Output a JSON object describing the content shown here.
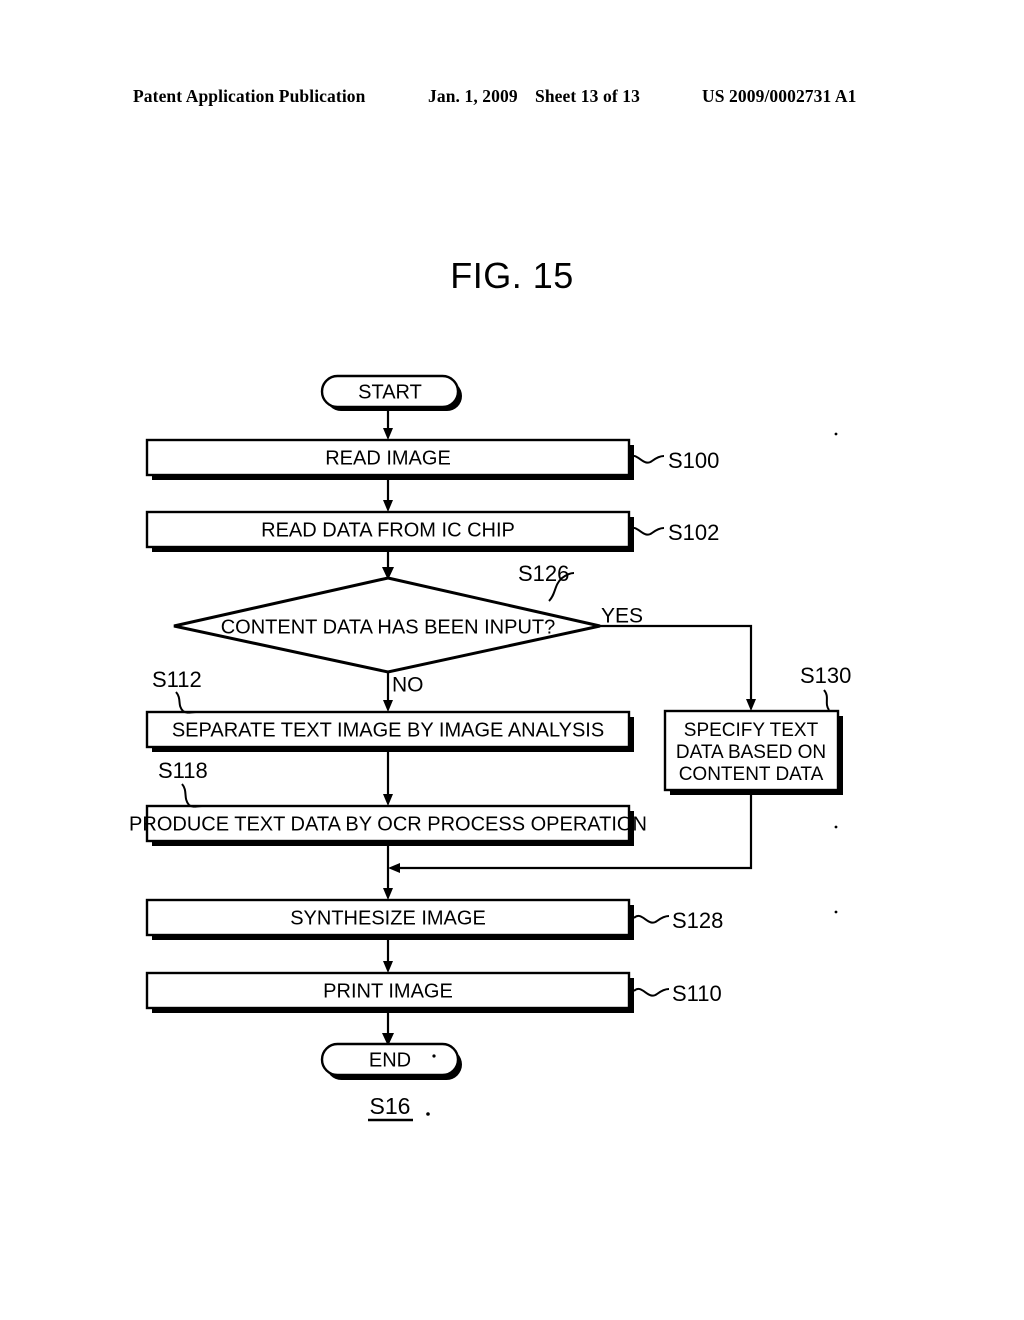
{
  "header": {
    "publication": "Patent Application Publication",
    "date": "Jan. 1, 2009",
    "sheet": "Sheet 13 of 13",
    "patent_number": "US 2009/0002731 A1"
  },
  "figure": {
    "title": "FIG. 15",
    "caption": "S16"
  },
  "flowchart": {
    "start_label": "START",
    "end_label": "END",
    "decision": {
      "text": "CONTENT DATA HAS BEEN INPUT?",
      "step": "S126",
      "yes_label": "YES",
      "no_label": "NO"
    },
    "steps": [
      {
        "text": "READ IMAGE",
        "step": "S100"
      },
      {
        "text": "READ DATA FROM IC CHIP",
        "step": "S102"
      },
      {
        "text": "SEPARATE TEXT IMAGE BY IMAGE ANALYSIS",
        "step": "S112"
      },
      {
        "text": "PRODUCE TEXT DATA BY OCR PROCESS OPERATION",
        "step": "S118"
      },
      {
        "text": "SYNTHESIZE IMAGE",
        "step": "S128"
      },
      {
        "text": "PRINT IMAGE",
        "step": "S110"
      }
    ],
    "branch_step": {
      "line1": "SPECIFY TEXT",
      "line2": "DATA BASED ON",
      "line3": "CONTENT DATA",
      "step": "S130"
    }
  },
  "colors": {
    "ink": "#000000",
    "paper": "#ffffff"
  }
}
